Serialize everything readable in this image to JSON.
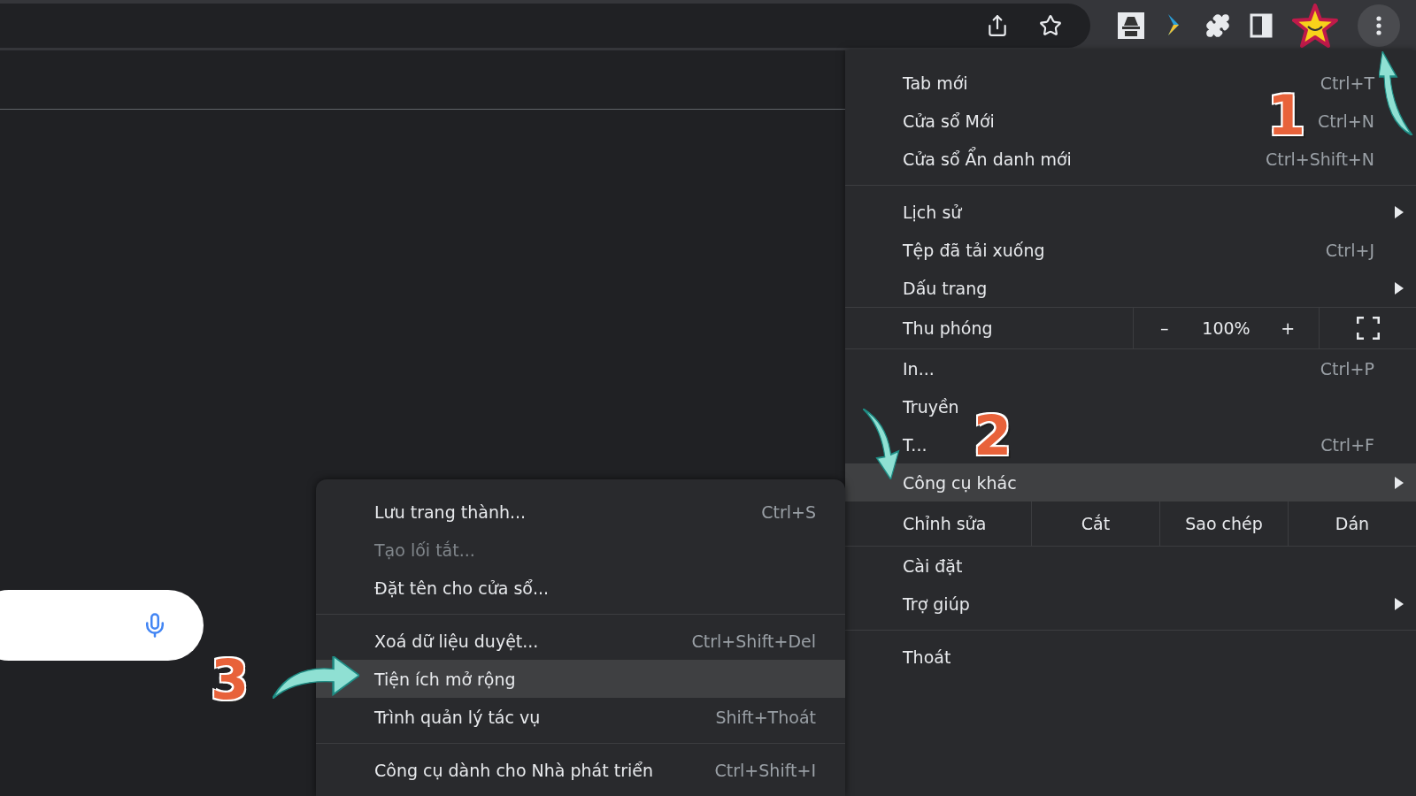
{
  "menu": {
    "items": [
      {
        "kind": "item",
        "label": "Tab mới",
        "shortcut": "Ctrl+T",
        "submenu": false,
        "selected": false,
        "disabled": false
      },
      {
        "kind": "item",
        "label": "Cửa sổ Mới",
        "shortcut": "Ctrl+N",
        "submenu": false,
        "selected": false,
        "disabled": false
      },
      {
        "kind": "item",
        "label": "Cửa sổ Ẩn danh mới",
        "shortcut": "Ctrl+Shift+N",
        "submenu": false,
        "selected": false,
        "disabled": false
      },
      {
        "kind": "separator"
      },
      {
        "kind": "item",
        "label": "Lịch sử",
        "submenu": true,
        "selected": false,
        "disabled": false
      },
      {
        "kind": "item",
        "label": "Tệp đã tải xuống",
        "shortcut": "Ctrl+J",
        "submenu": false,
        "selected": false,
        "disabled": false
      },
      {
        "kind": "item",
        "label": "Dấu trang",
        "submenu": true,
        "selected": false,
        "disabled": false
      },
      {
        "kind": "zoom",
        "label": "Thu phóng",
        "minus": "–",
        "value": "100%",
        "plus": "+"
      },
      {
        "kind": "item",
        "label": "In...",
        "shortcut": "Ctrl+P",
        "submenu": false,
        "selected": false,
        "disabled": false
      },
      {
        "kind": "item",
        "label": "Truyền",
        "submenu": false,
        "selected": false,
        "disabled": false
      },
      {
        "kind": "item",
        "label": "T...",
        "shortcut": "Ctrl+F",
        "submenu": false,
        "selected": false,
        "disabled": false
      },
      {
        "kind": "item",
        "label": "Công cụ khác",
        "submenu": true,
        "selected": true,
        "disabled": false
      },
      {
        "kind": "edit",
        "label": "Chỉnh sửa",
        "buttons": [
          "Cắt",
          "Sao chép",
          "Dán"
        ]
      },
      {
        "kind": "item",
        "label": "Cài đặt",
        "submenu": false,
        "selected": false,
        "disabled": false
      },
      {
        "kind": "item",
        "label": "Trợ giúp",
        "submenu": true,
        "selected": false,
        "disabled": false
      },
      {
        "kind": "separator"
      },
      {
        "kind": "item",
        "label": "Thoát",
        "submenu": false,
        "selected": false,
        "disabled": false
      }
    ]
  },
  "submenu": {
    "items": [
      {
        "kind": "item",
        "label": "Lưu trang thành...",
        "shortcut": "Ctrl+S",
        "selected": false,
        "disabled": false
      },
      {
        "kind": "item",
        "label": "Tạo lối tắt...",
        "selected": false,
        "disabled": true
      },
      {
        "kind": "item",
        "label": "Đặt tên cho cửa sổ...",
        "selected": false,
        "disabled": false
      },
      {
        "kind": "separator"
      },
      {
        "kind": "item",
        "label": "Xoá dữ liệu duyệt...",
        "shortcut": "Ctrl+Shift+Del",
        "selected": false,
        "disabled": false
      },
      {
        "kind": "item",
        "label": "Tiện ích mở rộng",
        "selected": true,
        "disabled": false
      },
      {
        "kind": "item",
        "label": "Trình quản lý tác vụ",
        "shortcut": "Shift+Thoát",
        "selected": false,
        "disabled": false
      },
      {
        "kind": "separator"
      },
      {
        "kind": "item",
        "label": "Công cụ dành cho Nhà phát triển",
        "shortcut": "Ctrl+Shift+I",
        "selected": false,
        "disabled": false
      }
    ]
  },
  "annotations": [
    {
      "number": "1"
    },
    {
      "number": "2"
    },
    {
      "number": "3"
    }
  ]
}
